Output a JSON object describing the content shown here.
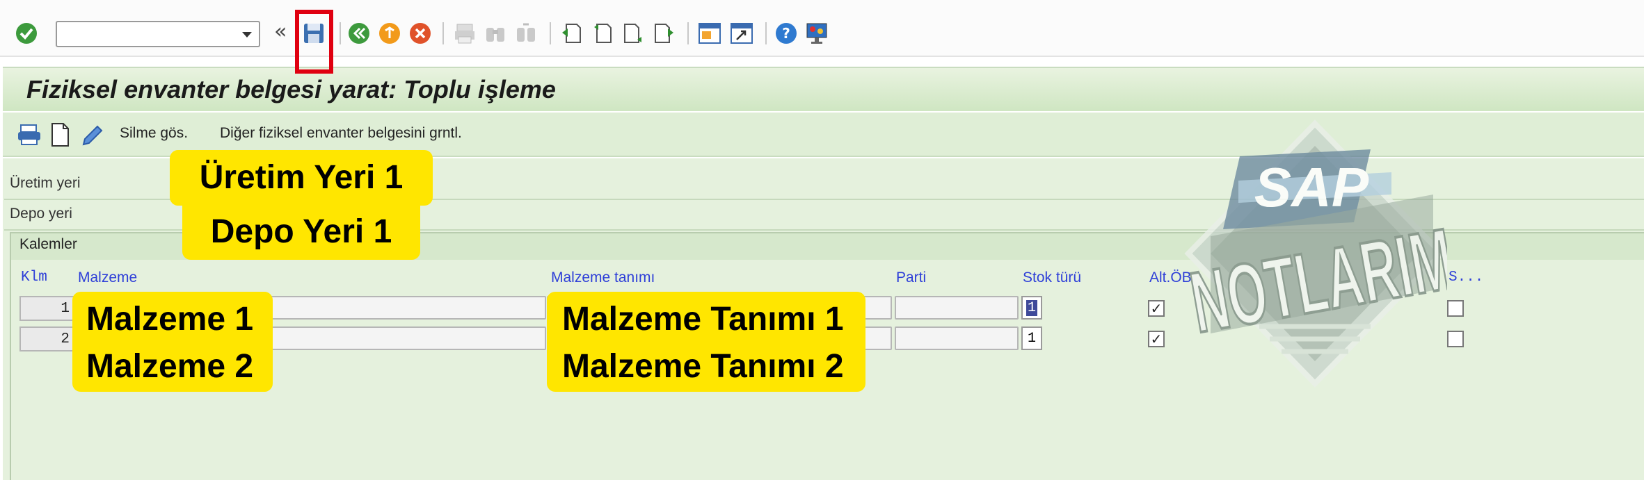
{
  "toolbar": {
    "command_field": {
      "value": "",
      "placeholder": ""
    },
    "double_arrow": "«",
    "icons": [
      "enter-icon",
      "save-icon",
      "back-icon",
      "exit-icon",
      "cancel-icon",
      "print-icon",
      "find-icon",
      "find-next-icon",
      "first-page-icon",
      "previous-page-icon",
      "next-page-icon",
      "last-page-icon",
      "create-session-icon",
      "shortcut-icon",
      "help-icon",
      "customize-layout-icon"
    ]
  },
  "title": "Fiziksel envanter belgesi yarat: Toplu işleme",
  "app_toolbar": {
    "icons": [
      "print-settings-icon",
      "new-document-icon",
      "edit-pen-icon"
    ],
    "show_deletion": "Silme gös.",
    "other_document": "Diğer fiziksel envanter belgesini grntl."
  },
  "header_fields": {
    "plant_label": "Üretim yeri",
    "storage_location_label": "Depo yeri"
  },
  "items": {
    "group_title": "Kalemler",
    "columns": [
      "Klm",
      "Malzeme",
      "Malzeme tanımı",
      "Parti",
      "Stok türü",
      "Alt.ÖB",
      "S..."
    ],
    "rows": [
      {
        "item": "1",
        "material": "",
        "description": "",
        "batch": "",
        "stock_type": "1",
        "alt_checked": true,
        "s_checked": false,
        "stock_selected": true
      },
      {
        "item": "2",
        "material": "",
        "description": "",
        "batch": "",
        "stock_type": "1",
        "alt_checked": true,
        "s_checked": false,
        "stock_selected": false
      }
    ]
  },
  "annotations": {
    "plant": "Üretim Yeri 1",
    "storage": "Depo Yeri 1",
    "materials": [
      "Malzeme 1",
      "Malzeme 2"
    ],
    "descriptions": [
      "Malzeme Tanımı 1",
      "Malzeme Tanımı 2"
    ]
  },
  "watermark": {
    "top_text": "SAP",
    "main_text": "NOTLARIM"
  },
  "colors": {
    "title_bg": "#cfe6c2",
    "work_bg": "#e5f1dd",
    "column_header_text": "#2e3fd8",
    "annotation_bg": "#ffe600",
    "highlight": "#e00010"
  }
}
